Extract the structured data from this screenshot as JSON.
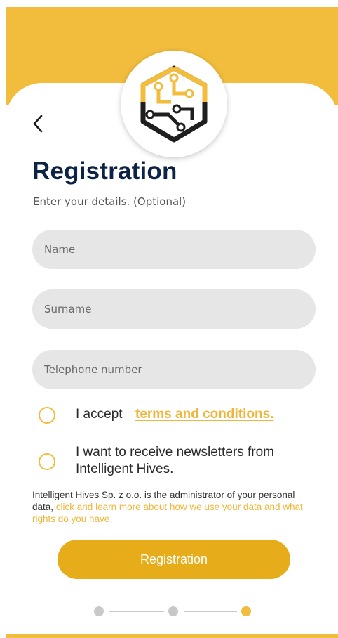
{
  "colors": {
    "brand": "#f2bd3d",
    "button": "#e6ac1a",
    "title": "#0d2346",
    "field_bg": "#e6e6e6",
    "link": "#f0b63a"
  },
  "header": {
    "logo_icon": "hexagon-circuit-logo-icon",
    "back_icon": "chevron-left-icon"
  },
  "page": {
    "title": "Registration",
    "subtitle": "Enter your details. (Optional)"
  },
  "form": {
    "name_placeholder": "Name",
    "surname_placeholder": "Surname",
    "phone_placeholder": "Telephone number"
  },
  "consents": {
    "terms_prefix": "I accept",
    "terms_link": "terms and conditions.",
    "newsletter": "I want to receive newsletters from Intelligent Hives."
  },
  "legal": {
    "text": "Intelligent Hives Sp. z o.o. is the administrator of your personal data,",
    "link": "click and learn more about how we use your data and what rights do you have."
  },
  "actions": {
    "register_label": "Registration"
  },
  "stepper": {
    "total_steps": 3,
    "current_step": 3
  }
}
